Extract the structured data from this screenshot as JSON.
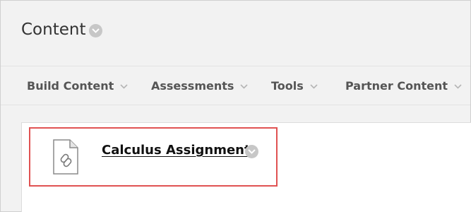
{
  "header": {
    "title": "Content"
  },
  "toolbar": {
    "items": [
      {
        "label": "Build Content"
      },
      {
        "label": "Assessments"
      },
      {
        "label": "Tools"
      },
      {
        "label": "Partner Content"
      }
    ]
  },
  "content": {
    "items": [
      {
        "title": "Calculus Assignment",
        "icon": "link-document-icon"
      }
    ]
  },
  "colors": {
    "background": "#f2f2f2",
    "highlight": "#e05252",
    "chevron_circle": "#c7c7c7",
    "toolbar_text": "#555555"
  }
}
